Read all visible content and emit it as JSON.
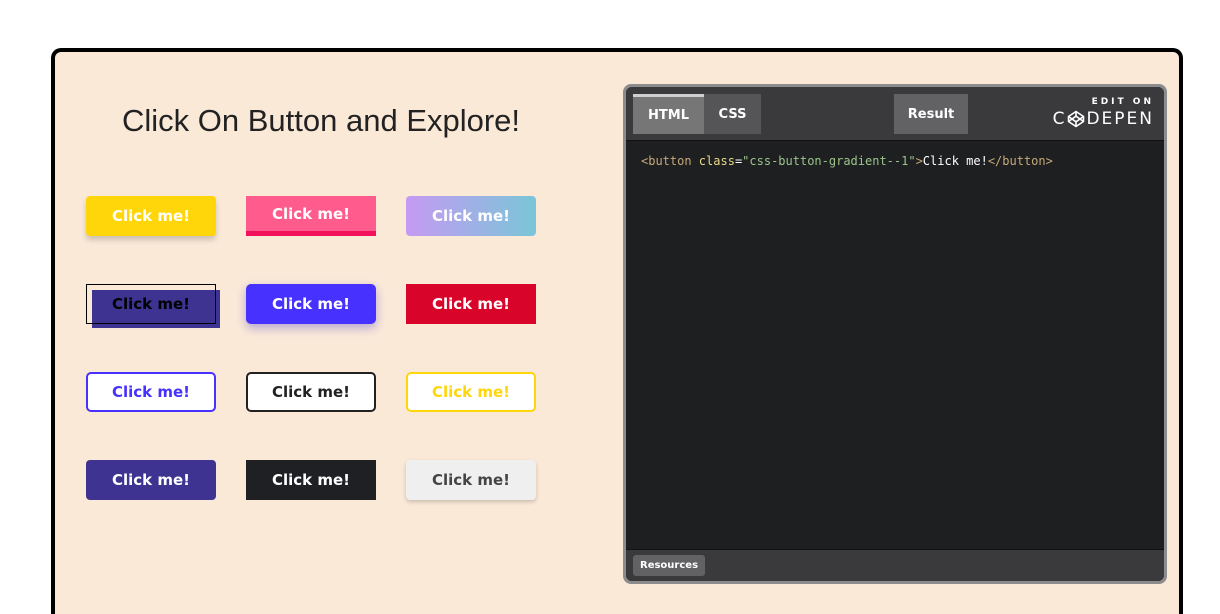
{
  "heading": "Click On Button and Explore!",
  "buttons": [
    {
      "label": "Click me!"
    },
    {
      "label": "Click me!"
    },
    {
      "label": "Click me!"
    },
    {
      "label": "Click me!"
    },
    {
      "label": "Click me!"
    },
    {
      "label": "Click me!"
    },
    {
      "label": "Click me!"
    },
    {
      "label": "Click me!"
    },
    {
      "label": "Click me!"
    },
    {
      "label": "Click me!"
    },
    {
      "label": "Click me!"
    },
    {
      "label": "Click me!"
    }
  ],
  "codepen": {
    "tabs": {
      "html": "HTML",
      "css": "CSS",
      "result": "Result"
    },
    "logo_top": "EDIT ON",
    "logo_left": "C",
    "logo_right": "DEPEN",
    "code": {
      "open_tag": "<button",
      "attr_name": " class",
      "equals": "=",
      "attr_value": "\"css-button-gradient--1\"",
      "close_bracket": ">",
      "text": "Click me!",
      "end_tag": "</button>"
    },
    "resources_label": "Resources"
  },
  "colors": {
    "page_bg": "#fbe9d8",
    "yellow": "#ffd60a",
    "pink": "#ff5c8d",
    "purple": "#4631ff",
    "indigo": "#3e3390",
    "red": "#d90429",
    "dark": "#1e2023"
  }
}
